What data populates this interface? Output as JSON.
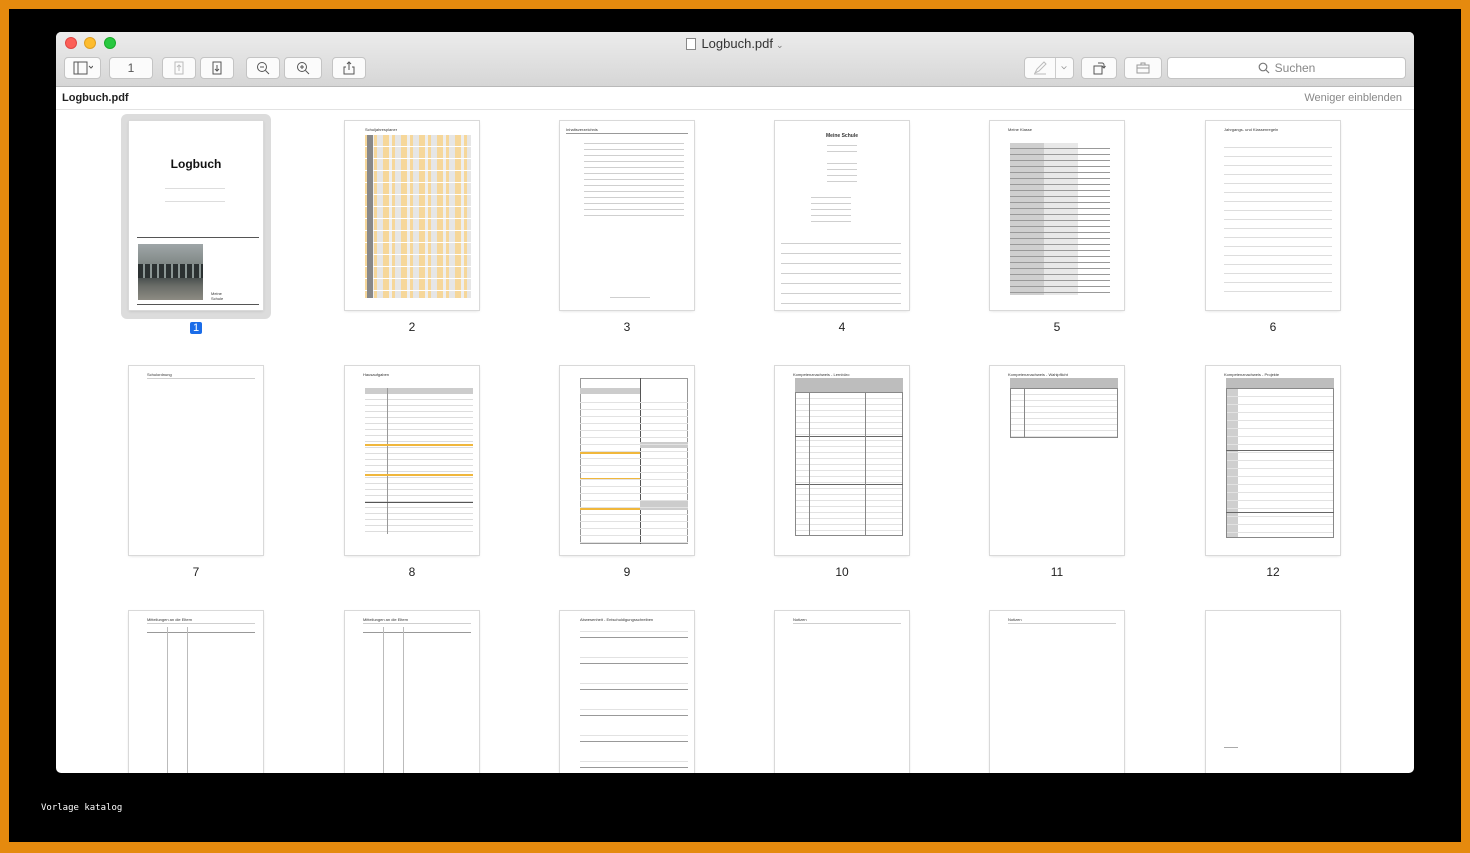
{
  "window": {
    "title": "Logbuch.pdf",
    "page_field": "1",
    "search_placeholder": "Suchen"
  },
  "pathbar": {
    "filename": "Logbuch.pdf",
    "toggle": "Weniger einblenden"
  },
  "cover": {
    "title": "Logbuch",
    "school": "Meine\nSchule"
  },
  "pages": [
    {
      "num": "1",
      "heading": "Logbuch",
      "selected": true
    },
    {
      "num": "2",
      "heading": "Schuljahresplaner"
    },
    {
      "num": "3",
      "heading": "Inhaltsverzeichnis"
    },
    {
      "num": "4",
      "heading": "Meine Schule"
    },
    {
      "num": "5",
      "heading": "Meine Klasse"
    },
    {
      "num": "6",
      "heading": "Jahrgangs- und Klassenregeln"
    },
    {
      "num": "7",
      "heading": "Schulordnung"
    },
    {
      "num": "8",
      "heading": "Hausaufgaben"
    },
    {
      "num": "9",
      "heading": ""
    },
    {
      "num": "10",
      "heading": "Kompetenznachweis - Lernbüro"
    },
    {
      "num": "11",
      "heading": "Kompetenznachweis - Wahlpflicht"
    },
    {
      "num": "12",
      "heading": "Kompetenznachweis - Projekte"
    },
    {
      "num": "",
      "heading": "Mitteilungen an die Eltern"
    },
    {
      "num": "",
      "heading": "Mitteilungen an die Eltern"
    },
    {
      "num": "",
      "heading": "Abwesenheit - Entschuldigungsschreiben"
    },
    {
      "num": "",
      "heading": "Notizen"
    },
    {
      "num": "",
      "heading": "Notizen"
    },
    {
      "num": "",
      "heading": ""
    }
  ],
  "overlay_caption": "Vorlage katalog"
}
